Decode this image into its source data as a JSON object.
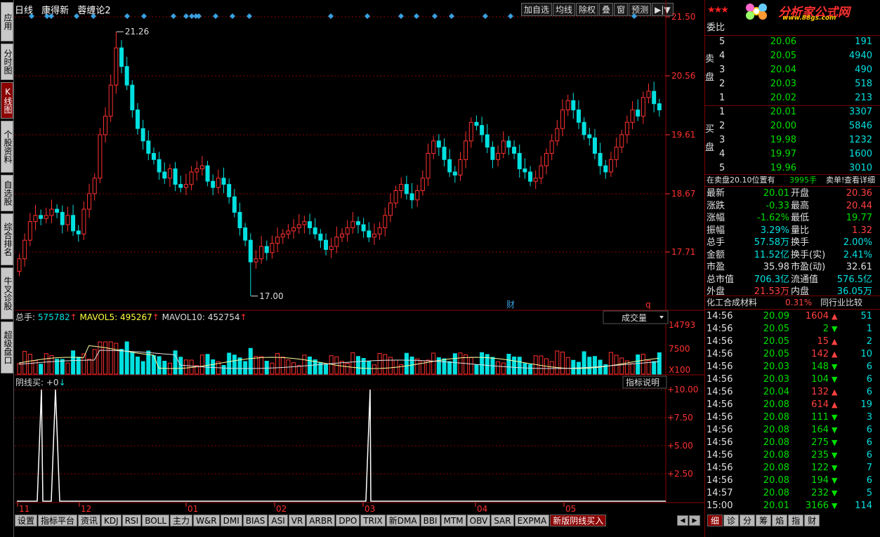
{
  "left_tabs": [
    "应用",
    "分时图",
    "K线图",
    "个股资料",
    "自选股",
    "综合排名",
    "牛叉诊股",
    "超级盘口"
  ],
  "active_left_tab": 2,
  "title": {
    "period": "日线",
    "stock": "康得新",
    "formula": "蓉缠论2"
  },
  "top_buttons": [
    "加自选",
    "均线",
    "除权",
    "叠",
    "窗",
    "预测",
    "▶|▼"
  ],
  "price_axis": [
    "21.50",
    "20.56",
    "19.61",
    "18.67",
    "17.71"
  ],
  "price_high_label": "21.26",
  "price_low_label": "17.00",
  "cai_label": "财",
  "q_label": "q",
  "volume_header": {
    "label": "总手:",
    "value": "575782",
    "mavol5_label": "MAVOL5:",
    "mavol5": "495267",
    "mavol10_label": "MAVOL10:",
    "mavol10": "452754",
    "arrow": "↑"
  },
  "volume_selector": "成交量",
  "volume_axis": [
    "14793",
    "7500",
    "X100"
  ],
  "indicator_header": {
    "label": "阴线买:",
    "value": "+0",
    "arrow": "↓"
  },
  "indicator_button": "指标说明",
  "indicator_axis": [
    "+10.00",
    "+7.50",
    "+5.00",
    "+2.50"
  ],
  "date_labels": [
    "11",
    "12",
    "01",
    "02",
    "03",
    "04",
    "05"
  ],
  "bottom_tabs": [
    "设置",
    "指标平台",
    "资讯",
    "KDJ",
    "RSI",
    "BOLL",
    "主力",
    "W&R",
    "DMI",
    "BIAS",
    "ASI",
    "VR",
    "ARBR",
    "DPO",
    "TRIX",
    "新DMA",
    "BBI",
    "MTM",
    "OBV",
    "SAR",
    "EXPMA",
    "新版阴线买入"
  ],
  "active_bottom_tab": 21,
  "logo": {
    "brand": "分析家公式网",
    "url": "www.88gs.com"
  },
  "weibi_label": "委比",
  "sell_label": "卖盘",
  "buy_label": "买盘",
  "sell_orders": [
    {
      "level": "5",
      "price": "20.06",
      "vol": "191"
    },
    {
      "level": "4",
      "price": "20.05",
      "vol": "4940"
    },
    {
      "level": "3",
      "price": "20.04",
      "vol": "490"
    },
    {
      "level": "2",
      "price": "20.03",
      "vol": "518"
    },
    {
      "level": "1",
      "price": "20.02",
      "vol": "213"
    }
  ],
  "buy_orders": [
    {
      "level": "1",
      "price": "20.01",
      "vol": "3307"
    },
    {
      "level": "2",
      "price": "20.00",
      "vol": "5846"
    },
    {
      "level": "3",
      "price": "19.98",
      "vol": "1232"
    },
    {
      "level": "4",
      "price": "19.97",
      "vol": "1600"
    },
    {
      "level": "5",
      "price": "19.96",
      "vol": "3010"
    }
  ],
  "notice": {
    "text": "在卖盘20.10位置有",
    "qty": "3995手",
    "tail": "卖单!",
    "link": "查看详细"
  },
  "quote": [
    {
      "l1": "最新",
      "v1": "20.01",
      "c1": "green",
      "l2": "开盘",
      "v2": "20.36",
      "c2": "red"
    },
    {
      "l1": "涨跌",
      "v1": "-0.33",
      "c1": "green",
      "l2": "最高",
      "v2": "20.44",
      "c2": "red"
    },
    {
      "l1": "涨幅",
      "v1": "-1.62%",
      "c1": "green",
      "l2": "最低",
      "v2": "19.77",
      "c2": "green"
    },
    {
      "l1": "振幅",
      "v1": "3.29%",
      "c1": "cyan",
      "l2": "量比",
      "v2": "1.32",
      "c2": "red"
    },
    {
      "l1": "总手",
      "v1": "57.58万",
      "c1": "cyan",
      "l2": "换手",
      "v2": "2.00%",
      "c2": "cyan"
    },
    {
      "l1": "金额",
      "v1": "11.52亿",
      "c1": "cyan",
      "l2": "换手(实)",
      "v2": "2.41%",
      "c2": "cyan"
    },
    {
      "l1": "市盈",
      "v1": "35.98",
      "c1": "white",
      "l2": "市盈(动)",
      "v2": "32.61",
      "c2": "white"
    },
    {
      "l1": "总市值",
      "v1": "706.3亿",
      "c1": "cyan",
      "l2": "流通值",
      "v2": "576.5亿",
      "c2": "cyan"
    },
    {
      "l1": "外盘",
      "v1": "21.53万",
      "c1": "red",
      "l2": "内盘",
      "v2": "36.05万",
      "c2": "cyan"
    }
  ],
  "industry": {
    "name": "化工合成材料",
    "pct": "0.31%",
    "button": "同行业比较"
  },
  "ticks": [
    {
      "t": "14:56",
      "p": "20.09",
      "v": "1604",
      "d": "up",
      "n": "51"
    },
    {
      "t": "14:56",
      "p": "20.05",
      "v": "2",
      "d": "down",
      "n": "1"
    },
    {
      "t": "14:56",
      "p": "20.05",
      "v": "15",
      "d": "up",
      "n": "2"
    },
    {
      "t": "14:56",
      "p": "20.05",
      "v": "142",
      "d": "up",
      "n": "10"
    },
    {
      "t": "14:56",
      "p": "20.03",
      "v": "148",
      "d": "down",
      "n": "6"
    },
    {
      "t": "14:56",
      "p": "20.03",
      "v": "104",
      "d": "down",
      "n": "6"
    },
    {
      "t": "14:56",
      "p": "20.04",
      "v": "132",
      "d": "up",
      "n": "6"
    },
    {
      "t": "14:56",
      "p": "20.08",
      "v": "614",
      "d": "up",
      "n": "19"
    },
    {
      "t": "14:56",
      "p": "20.08",
      "v": "111",
      "d": "down",
      "n": "3"
    },
    {
      "t": "14:56",
      "p": "20.08",
      "v": "164",
      "d": "down",
      "n": "6"
    },
    {
      "t": "14:56",
      "p": "20.08",
      "v": "275",
      "d": "down",
      "n": "6"
    },
    {
      "t": "14:56",
      "p": "20.08",
      "v": "235",
      "d": "down",
      "n": "6"
    },
    {
      "t": "14:56",
      "p": "20.08",
      "v": "122",
      "d": "down",
      "n": "7"
    },
    {
      "t": "14:56",
      "p": "20.08",
      "v": "194",
      "d": "down",
      "n": "6"
    },
    {
      "t": "14:57",
      "p": "20.08",
      "v": "232",
      "d": "down",
      "n": "5"
    },
    {
      "t": "15:00",
      "p": "20.01",
      "v": "3166",
      "d": "down",
      "n": "114"
    }
  ],
  "right_bottom_tabs": [
    "细",
    "诊",
    "分",
    "筹",
    "焰",
    "指",
    "财"
  ],
  "colors": {
    "up": "#ff3030",
    "down": "#00e0e0",
    "grid": "#8b0000",
    "axis": "#ff3030"
  }
}
